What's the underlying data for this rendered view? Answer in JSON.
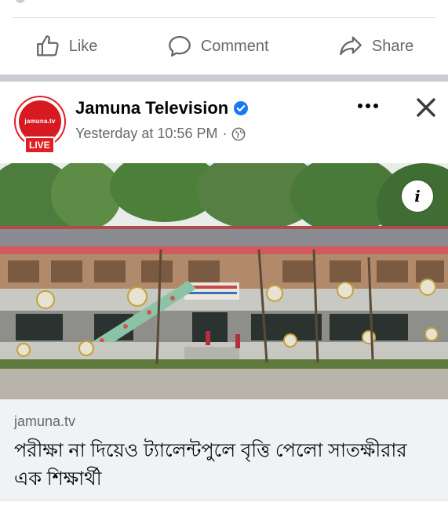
{
  "actions": {
    "like_label": "Like",
    "comment_label": "Comment",
    "share_label": "Share"
  },
  "post": {
    "page_name": "Jamuna Television",
    "avatar_brand": "jamuna.tv",
    "avatar_live": "LIVE",
    "timestamp": "Yesterday at 10:56 PM",
    "separator": "·",
    "link": {
      "domain": "jamuna.tv",
      "headline": "পরীক্ষা না দিয়েও ট্যালেন্টপুলে বৃত্তি পেলো সাতক্ষীরার এক শিক্ষার্থী"
    },
    "info_icon_label": "i"
  },
  "colors": {
    "brand_red": "#e41e26",
    "verified_blue": "#1877f2",
    "muted_text": "#65676b"
  }
}
